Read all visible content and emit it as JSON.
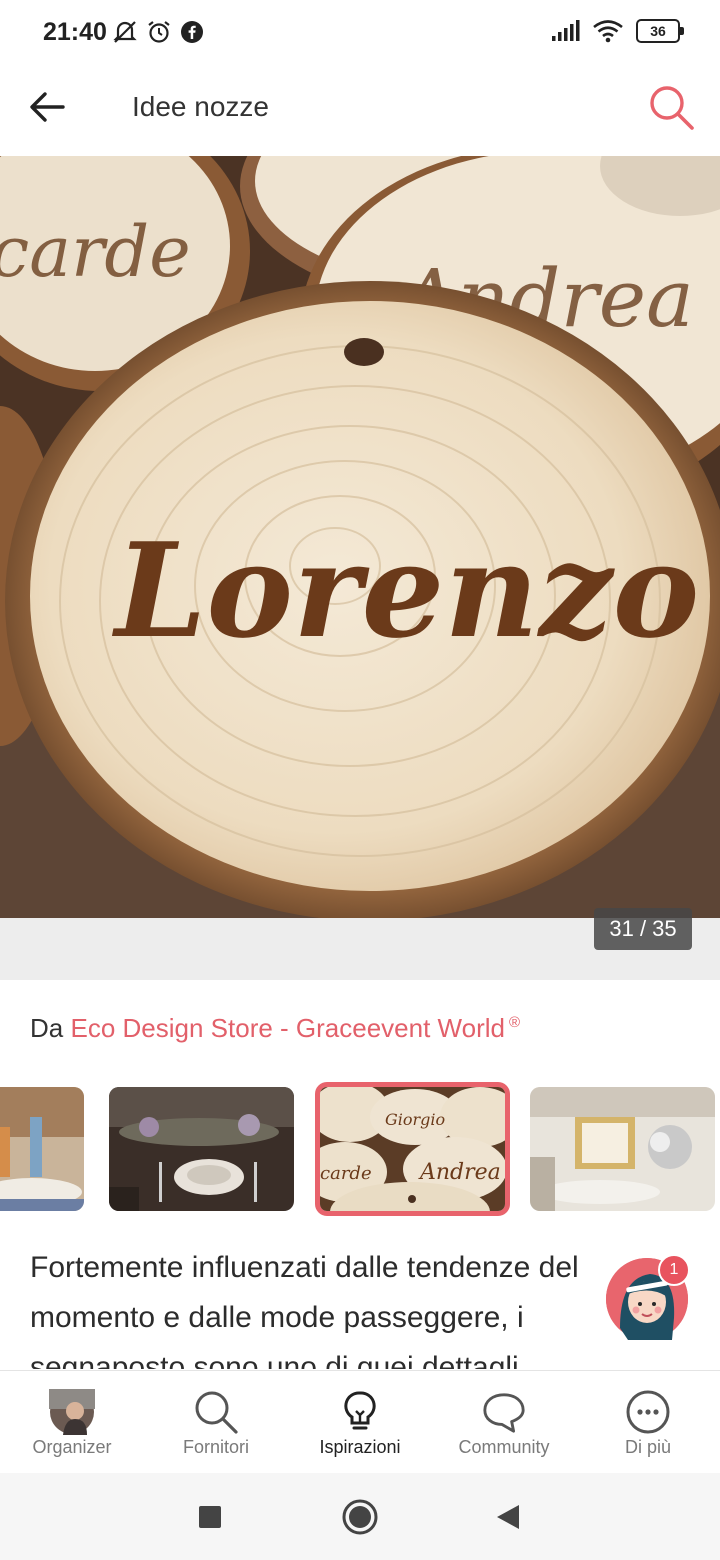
{
  "status_bar": {
    "time": "21:40",
    "battery": "36",
    "icons": [
      "muted-bell-icon",
      "alarm-icon",
      "facebook-icon",
      "signal-icon",
      "wifi-icon",
      "battery-icon"
    ]
  },
  "header": {
    "title": "Idee nozze",
    "back_icon": "arrow-left-icon",
    "search_icon": "search-icon",
    "accent_color": "#e8636c"
  },
  "gallery": {
    "counter": "31 / 35",
    "photo_text": "Lorenzo"
  },
  "author": {
    "prefix": "Da",
    "vendor": "Eco Design Store - Graceevent World",
    "mark": "®"
  },
  "description": {
    "text": "Fortemente influenzati dalle tendenze del momento e dalle mode passeggere, i segnaposto sono uno di quei dettagli"
  },
  "assistant": {
    "badge_count": "1"
  },
  "bottom_nav": {
    "items": [
      {
        "label": "Organizer",
        "icon": "avatar-icon"
      },
      {
        "label": "Fornitori",
        "icon": "search-icon"
      },
      {
        "label": "Ispirazioni",
        "icon": "lightbulb-icon",
        "active": true
      },
      {
        "label": "Community",
        "icon": "chat-bubble-icon"
      },
      {
        "label": "Di più",
        "icon": "more-dots-icon"
      }
    ]
  },
  "system_nav": {
    "icons": [
      "recents-square-icon",
      "home-circle-icon",
      "back-triangle-icon"
    ]
  }
}
